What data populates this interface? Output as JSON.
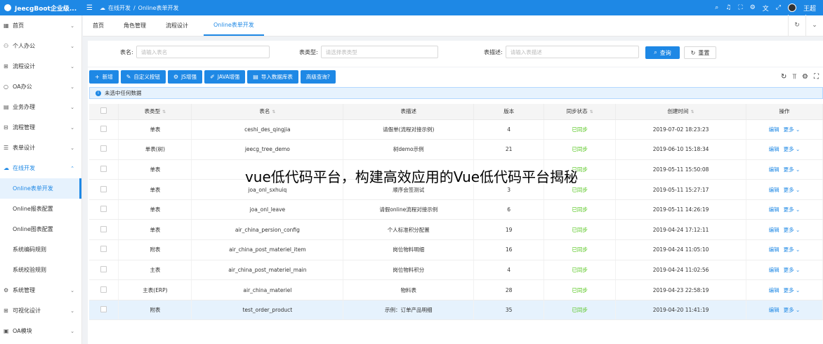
{
  "app": {
    "title": "JeecgBoot企业级...",
    "user": "王超"
  },
  "breadcrumb": {
    "parent": "在线开发",
    "sep": "/",
    "current": "Online表单开发"
  },
  "topbar_icons": [
    "search-icon",
    "bell-icon",
    "fullscreen-icon",
    "setting-icon",
    "translate-icon",
    "expand-icon"
  ],
  "sidebar": {
    "items": [
      {
        "label": "首页",
        "icon": "home-icon"
      },
      {
        "label": "个人办公",
        "icon": "user-icon"
      },
      {
        "label": "流程设计",
        "icon": "flow-icon"
      },
      {
        "label": "OA办公",
        "icon": "oa-icon"
      },
      {
        "label": "业务办理",
        "icon": "business-icon"
      },
      {
        "label": "流程管理",
        "icon": "manage-icon"
      },
      {
        "label": "表单设计",
        "icon": "form-icon"
      },
      {
        "label": "在线开发",
        "icon": "cloud-icon"
      }
    ],
    "sub_items": [
      "Online表单开发",
      "Online报表配置",
      "Online图表配置",
      "系统编码规则",
      "系统校验规则"
    ],
    "items_after": [
      {
        "label": "系统管理",
        "icon": "gear-icon"
      },
      {
        "label": "可视化设计",
        "icon": "chart-icon"
      },
      {
        "label": "OA模块",
        "icon": "module-icon"
      }
    ]
  },
  "tabs": [
    "首页",
    "角色管理",
    "流程设计",
    "Online表单开发"
  ],
  "search": {
    "name_label": "表名:",
    "name_placeholder": "请输入表名",
    "type_label": "表类型:",
    "type_placeholder": "请选择表类型",
    "desc_label": "表描述:",
    "desc_placeholder": "请输入表描述",
    "query_label": "查询",
    "reset_label": "重置"
  },
  "toolbar": {
    "buttons": [
      "新增",
      "自定义按钮",
      "JS增强",
      "JAVA增强",
      "导入数据库表",
      "高级查询?"
    ]
  },
  "alert": "未选中任何数据",
  "table": {
    "headers": [
      "表类型",
      "表名",
      "表描述",
      "版本",
      "同步状态",
      "创建时间",
      "操作"
    ],
    "edit_label": "编辑",
    "more_label": "更多",
    "rows": [
      [
        "单表",
        "ceshi_des_qingjia",
        "请假单(流程对接示例)",
        "4",
        "已同步",
        "2019-07-02 18:23:23"
      ],
      [
        "单表(树)",
        "jeecg_tree_demo",
        "树demo示例",
        "21",
        "已同步",
        "2019-06-10 15:18:34"
      ],
      [
        "单表",
        "",
        "",
        "",
        "已同步",
        "2019-05-11 15:50:08"
      ],
      [
        "单表",
        "joa_onl_sxhuiq",
        "顺序会签测试",
        "3",
        "已同步",
        "2019-05-11 15:27:17"
      ],
      [
        "单表",
        "joa_onl_leave",
        "请假online流程对接示例",
        "6",
        "已同步",
        "2019-05-11 14:26:19"
      ],
      [
        "单表",
        "air_china_persion_config",
        "个人标准积分配置",
        "19",
        "已同步",
        "2019-04-24 17:12:11"
      ],
      [
        "附表",
        "air_china_post_materiel_item",
        "岗位物料明细",
        "16",
        "已同步",
        "2019-04-24 11:05:10"
      ],
      [
        "主表",
        "air_china_post_materiel_main",
        "岗位物料积分",
        "4",
        "已同步",
        "2019-04-24 11:02:56"
      ],
      [
        "主表(ERP)",
        "air_china_materiel",
        "物料表",
        "28",
        "已同步",
        "2019-04-23 22:58:19"
      ],
      [
        "附表",
        "test_order_product",
        "示例：订单产品明细",
        "35",
        "已同步",
        "2019-04-20 11:41:19"
      ]
    ]
  },
  "overlay_caption": "vue低代码平台，构建高效应用的Vue低代码平台揭秘",
  "colors": {
    "primary": "#1e88e5",
    "success": "#52c41a"
  }
}
